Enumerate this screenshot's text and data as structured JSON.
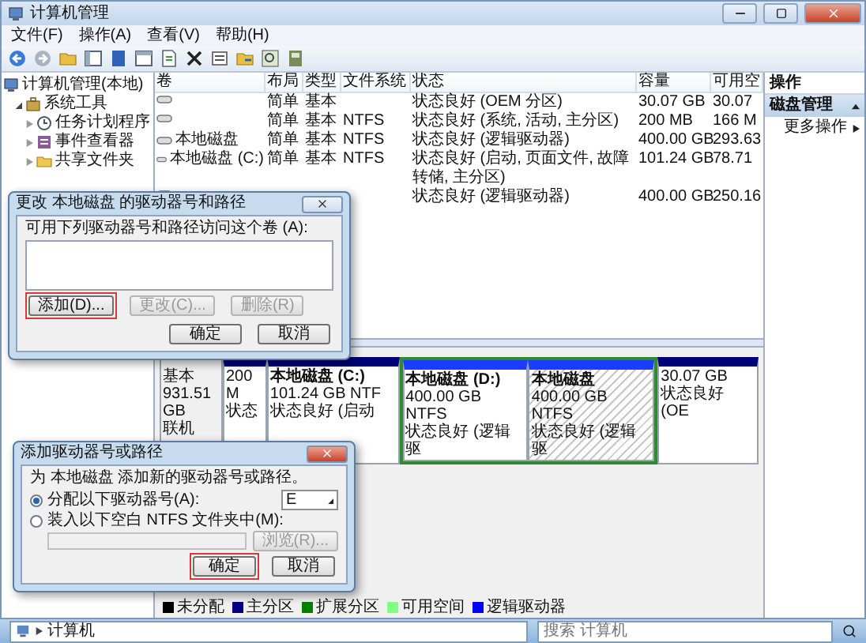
{
  "window": {
    "title": "计算机管理"
  },
  "menu": [
    {
      "label": "文件(F)"
    },
    {
      "label": "操作(A)"
    },
    {
      "label": "查看(V)"
    },
    {
      "label": "帮助(H)"
    }
  ],
  "tree": [
    {
      "label": "计算机管理(本地)",
      "children": [
        {
          "label": "系统工具",
          "expanded": true,
          "children": [
            {
              "label": "任务计划程序",
              "expanded": false
            },
            {
              "label": "事件查看器",
              "expanded": false
            },
            {
              "label": "共享文件夹",
              "expanded": false
            }
          ]
        }
      ]
    }
  ],
  "volumes": {
    "columns": [
      "卷",
      "布局",
      "类型",
      "文件系统",
      "状态",
      "容量",
      "可用空"
    ],
    "rows": [
      {
        "layout": "简单",
        "type": "基本",
        "status": "状态良好 (OEM 分区)",
        "capacity": "30.07 GB",
        "free": "30.07"
      },
      {
        "layout": "简单",
        "type": "基本",
        "fs": "NTFS",
        "status": "状态良好 (系统, 活动, 主分区)",
        "capacity": "200 MB",
        "free": "166 M"
      },
      {
        "volume": "本地磁盘",
        "layout": "简单",
        "type": "基本",
        "fs": "NTFS",
        "status": "状态良好 (逻辑驱动器)",
        "capacity": "400.00 GB",
        "free": "293.63"
      },
      {
        "volume": "本地磁盘 (C:)",
        "layout": "简单",
        "type": "基本",
        "fs": "NTFS",
        "status": "状态良好 (启动, 页面文件, 故障转储, 主分区)",
        "capacity": "101.24 GB",
        "free": "78.71"
      },
      {
        "status": "状态良好 (逻辑驱动器)",
        "capacity": "400.00 GB",
        "free": "250.16"
      }
    ]
  },
  "disk": {
    "label": [
      "基本",
      "931.51 GB",
      "联机"
    ],
    "partitions": [
      {
        "kind": "primary",
        "selected": false,
        "size": "200 M",
        "status": "状态"
      },
      {
        "kind": "primary",
        "selected": false,
        "name": "本地磁盘 (C:)",
        "size": "101.24 GB NTF",
        "status": "状态良好 (启动"
      },
      {
        "kind": "logical",
        "selected": false,
        "name": "本地磁盘 (D:)",
        "size": "400.00 GB NTFS",
        "status": "状态良好 (逻辑驱"
      },
      {
        "kind": "logical",
        "selected": true,
        "name": "本地磁盘",
        "size": "400.00 GB NTFS",
        "status": "状态良好 (逻辑驱"
      },
      {
        "kind": "primary",
        "selected": false,
        "size": "30.07 GB",
        "status": "状态良好 (OE"
      }
    ]
  },
  "legend": [
    {
      "label": "未分配",
      "color": "#000000"
    },
    {
      "label": "主分区",
      "color": "#000080"
    },
    {
      "label": "扩展分区",
      "color": "#008000"
    },
    {
      "label": "可用空间",
      "color": "#80ff80"
    },
    {
      "label": "逻辑驱动器",
      "color": "#0000ff"
    }
  ],
  "actions": {
    "title": "操作",
    "section": {
      "label": "磁盘管理",
      "expanded": true
    },
    "items": [
      {
        "label": "更多操作"
      }
    ]
  },
  "change_dialog": {
    "title": "更改 本地磁盘 的驱动器号和路径",
    "prompt": "可用下列驱动器号和路径访问这个卷 (A):",
    "buttons": [
      {
        "label": "添加(D)...",
        "disabled": false,
        "highlighted": true
      },
      {
        "label": "更改(C)...",
        "disabled": true,
        "highlighted": false
      },
      {
        "label": "删除(R)",
        "disabled": true,
        "highlighted": false
      }
    ],
    "footer_buttons": [
      {
        "label": "确定",
        "highlighted": false
      },
      {
        "label": "取消",
        "highlighted": false
      }
    ]
  },
  "add_dialog": {
    "title": "添加驱动器号或路径",
    "prompt": "为 本地磁盘 添加新的驱动器号或路径。",
    "options": [
      {
        "label": "分配以下驱动器号(A):",
        "selected": true
      },
      {
        "label": "装入以下空白 NTFS 文件夹中(M):",
        "selected": false
      }
    ],
    "drive_letter": "E",
    "browse": {
      "label": "浏览(R)...",
      "disabled": true
    },
    "footer_buttons": [
      {
        "label": "确定",
        "highlighted": true
      },
      {
        "label": "取消",
        "highlighted": false
      }
    ]
  },
  "explorer_bar": {
    "address": "计算机",
    "search_placeholder": "搜索 计算机"
  }
}
